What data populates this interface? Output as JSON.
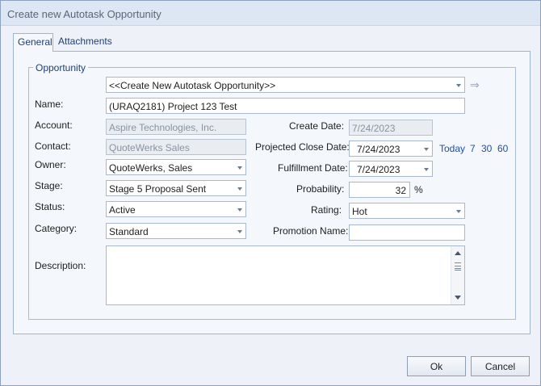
{
  "window": {
    "title": "Create new Autotask Opportunity"
  },
  "tabs": [
    {
      "label": "General",
      "active": true
    },
    {
      "label": "Attachments",
      "active": false
    }
  ],
  "group": {
    "title": "Opportunity"
  },
  "opportunity_select": {
    "value": "<<Create New Autotask Opportunity>>"
  },
  "form": {
    "name": {
      "label": "Name:",
      "value": "(URAQ2181) Project 123 Test"
    },
    "account": {
      "label": "Account:",
      "value": "Aspire Technologies, Inc."
    },
    "contact": {
      "label": "Contact:",
      "value": "QuoteWerks Sales"
    },
    "owner": {
      "label": "Owner:",
      "value": "QuoteWerks, Sales"
    },
    "stage": {
      "label": "Stage:",
      "value": "Stage 5 Proposal Sent"
    },
    "status": {
      "label": "Status:",
      "value": "Active"
    },
    "category": {
      "label": "Category:",
      "value": "Standard"
    },
    "description": {
      "label": "Description:",
      "value": ""
    },
    "create_date": {
      "label": "Create Date:",
      "value": "7/24/2023"
    },
    "projected_close_date": {
      "label": "Projected Close Date:",
      "value": "7/24/2023"
    },
    "fulfillment_date": {
      "label": "Fulfillment Date:",
      "value": "7/24/2023"
    },
    "probability": {
      "label": "Probability:",
      "value": "32",
      "unit": "%"
    },
    "rating": {
      "label": "Rating:",
      "value": "Hot"
    },
    "promotion_name": {
      "label": "Promotion Name:",
      "value": ""
    }
  },
  "date_shortcuts": {
    "today": "Today",
    "d7": "7",
    "d30": "30",
    "d60": "60"
  },
  "buttons": {
    "ok": "Ok",
    "cancel": "Cancel"
  },
  "colors": {
    "link": "#1f4fa8",
    "title_bar": "#dde7f3",
    "panel": "#f4f7fb"
  }
}
